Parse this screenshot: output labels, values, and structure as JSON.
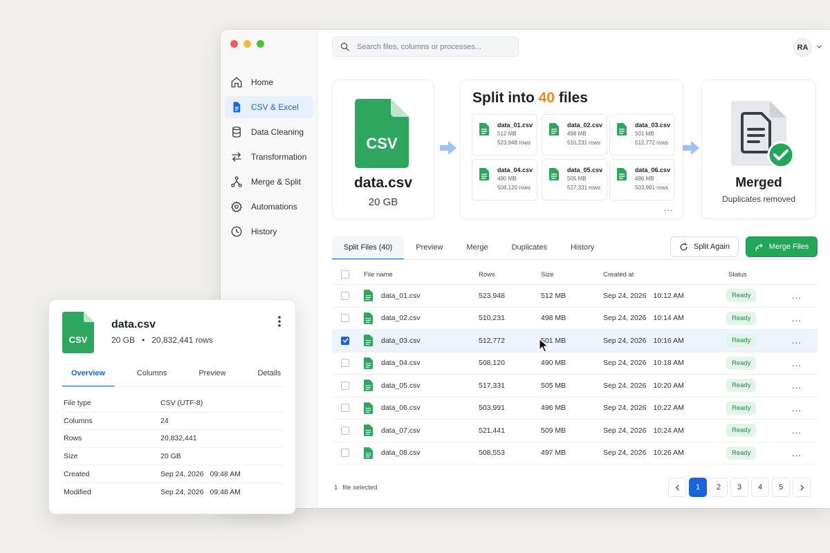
{
  "search": {
    "placeholder": "Search files, columns or processes..."
  },
  "user": {
    "initials": "RA"
  },
  "sidebar": {
    "items": [
      {
        "label": "Home",
        "icon": "home-icon"
      },
      {
        "label": "CSV & Excel",
        "icon": "document-icon",
        "active": true
      },
      {
        "label": "Data Cleaning",
        "icon": "database-icon"
      },
      {
        "label": "Transformation",
        "icon": "swap-arrows-icon"
      },
      {
        "label": "Merge & Split",
        "icon": "merge-split-icon"
      },
      {
        "label": "Automations",
        "icon": "gear-icon"
      },
      {
        "label": "History",
        "icon": "clock-icon"
      }
    ]
  },
  "source": {
    "badge": "CSV",
    "name": "data.csv",
    "size": "20 GB"
  },
  "split": {
    "title_prefix": "Split into",
    "count": "40",
    "title_suffix": "files",
    "chunks": [
      {
        "name": "data_01.csv",
        "size": "512 MB",
        "rows": "523,948 rows"
      },
      {
        "name": "data_02.csv",
        "size": "498 MB",
        "rows": "510,231 rows"
      },
      {
        "name": "data_03.csv",
        "size": "501 MB",
        "rows": "512,772 rows"
      },
      {
        "name": "data_04.csv",
        "size": "490 MB",
        "rows": "508,120 rows"
      },
      {
        "name": "data_05.csv",
        "size": "505 MB",
        "rows": "517,331 rows"
      },
      {
        "name": "data_06.csv",
        "size": "496 MB",
        "rows": "503,991 rows"
      }
    ],
    "more": "..."
  },
  "merged": {
    "title": "Merged",
    "subtitle": "Duplicates removed"
  },
  "tabs": [
    "Split Files (40)",
    "Preview",
    "Merge",
    "Duplicates",
    "History"
  ],
  "actions": {
    "split_again": "Split Again",
    "merge_files": "Merge Files"
  },
  "table": {
    "columns": [
      "File name",
      "Rows",
      "Size",
      "Created at",
      "Status"
    ],
    "rows": [
      {
        "name": "data_01.csv",
        "rows": "523,948",
        "size": "512 MB",
        "date": "Sep 24, 2026",
        "time": "10:12 AM",
        "status": "Ready",
        "checked": false
      },
      {
        "name": "data_02.csv",
        "rows": "510,231",
        "size": "498 MB",
        "date": "Sep 24, 2026",
        "time": "10:14 AM",
        "status": "Ready",
        "checked": false
      },
      {
        "name": "data_03.csv",
        "rows": "512,772",
        "size": "501 MB",
        "date": "Sep 24, 2026",
        "time": "10:16 AM",
        "status": "Ready",
        "checked": true
      },
      {
        "name": "data_04.csv",
        "rows": "508,120",
        "size": "490 MB",
        "date": "Sep 24, 2026",
        "time": "10:18 AM",
        "status": "Ready",
        "checked": false
      },
      {
        "name": "data_05.csv",
        "rows": "517,331",
        "size": "505 MB",
        "date": "Sep 24, 2026",
        "time": "10:20 AM",
        "status": "Ready",
        "checked": false
      },
      {
        "name": "data_06.csv",
        "rows": "503,991",
        "size": "496 MB",
        "date": "Sep 24, 2026",
        "time": "10:22 AM",
        "status": "Ready",
        "checked": false
      },
      {
        "name": "data_07.csv",
        "rows": "521,441",
        "size": "509 MB",
        "date": "Sep 24, 2026",
        "time": "10:24 AM",
        "status": "Ready",
        "checked": false
      },
      {
        "name": "data_08.csv",
        "rows": "508,553",
        "size": "497 MB",
        "date": "Sep 24, 2026",
        "time": "10:26 AM",
        "status": "Ready",
        "checked": false
      }
    ],
    "more": "..."
  },
  "footer": {
    "selected_count": "1",
    "selected_label": "file selected",
    "pages": [
      "1",
      "2",
      "3",
      "4",
      "5"
    ],
    "current_page": "1"
  },
  "details": {
    "badge": "CSV",
    "name": "data.csv",
    "size": "20 GB",
    "separator": "•",
    "rows": "20,832,441 rows",
    "tabs": [
      "Overview",
      "Columns",
      "Preview",
      "Details"
    ],
    "props": [
      {
        "key": "File type",
        "value": "CSV (UTF-8)"
      },
      {
        "key": "Columns",
        "value": "24"
      },
      {
        "key": "Rows",
        "value": "20,832,441"
      },
      {
        "key": "Size",
        "value": "20 GB"
      },
      {
        "key": "Created",
        "date": "Sep 24, 2026",
        "time": "09:48 AM"
      },
      {
        "key": "Modified",
        "date": "Sep 24, 2026",
        "time": "09:48 AM"
      }
    ]
  },
  "colors": {
    "accent": "#1a66d8",
    "green": "#22a658",
    "file_green": "#2fa660",
    "orange": "#ec8a16",
    "ready_bg": "#e3f5e9",
    "ready_text": "#1b8a4a"
  }
}
